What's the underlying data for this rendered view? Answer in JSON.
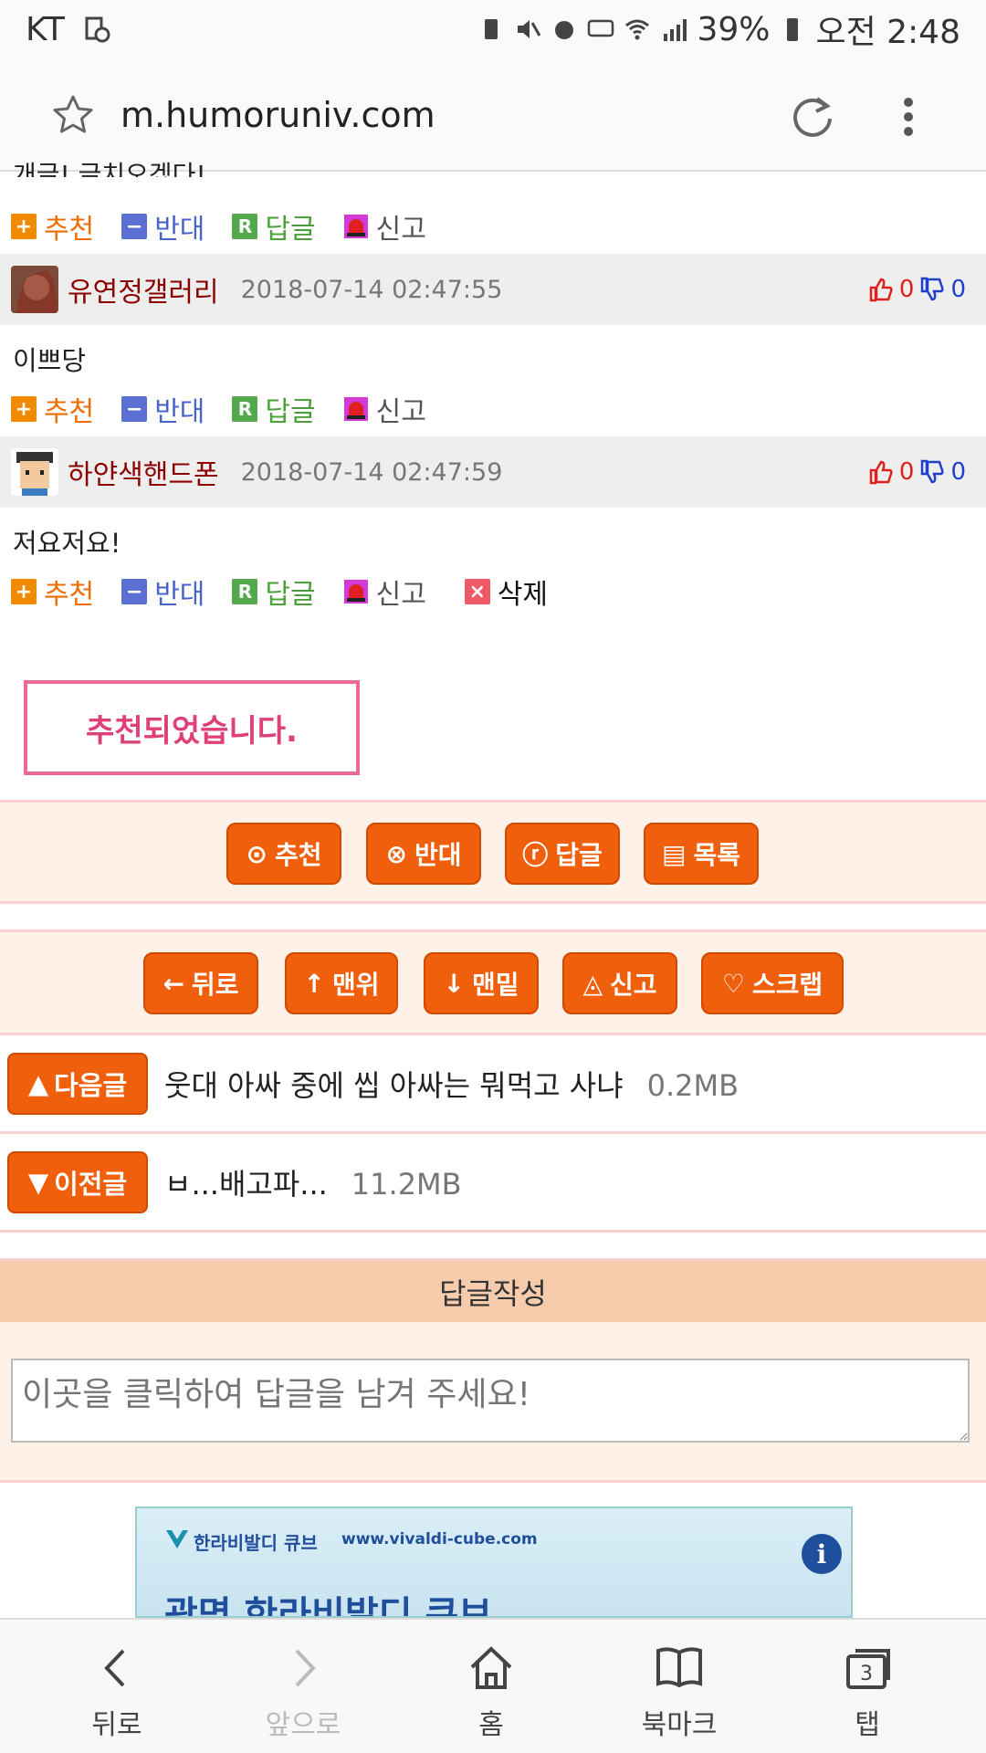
{
  "status_bar": {
    "carrier": "KT",
    "battery": "39%",
    "time": "오전 2:48"
  },
  "browser": {
    "url": "m.humoruniv.com"
  },
  "comment_actions": {
    "recommend": "추천",
    "oppose": "반대",
    "reply": "답글",
    "report": "신고",
    "delete": "삭제",
    "recommend_symbol": "+",
    "oppose_symbol": "−",
    "reply_symbol": "R",
    "delete_symbol": "×"
  },
  "truncated_text": "개글! 글치오겠다!",
  "comments": [
    {
      "nickname": "유연정갤러리",
      "time": "2018-07-14 02:47:55",
      "up": "0",
      "down": "0",
      "text": "이쁘당"
    },
    {
      "nickname": "하얀색핸드폰",
      "time": "2018-07-14 02:47:59",
      "up": "0",
      "down": "0",
      "text": "저요저요!"
    }
  ],
  "notice": "추천되었습니다.",
  "post_buttons": [
    {
      "icon": "⊙",
      "label": "추천"
    },
    {
      "icon": "⊗",
      "label": "반대"
    },
    {
      "icon": "ⓡ",
      "label": "답글"
    },
    {
      "icon": "▤",
      "label": "목록"
    }
  ],
  "nav_buttons": [
    {
      "icon": "←",
      "label": "뒤로"
    },
    {
      "icon": "↑",
      "label": "맨위"
    },
    {
      "icon": "↓",
      "label": "맨밑"
    },
    {
      "icon": "◬",
      "label": "신고"
    },
    {
      "icon": "♡",
      "label": "스크랩"
    }
  ],
  "next_post": {
    "label": "다음글",
    "icon": "▲",
    "title": "웃대 아싸 중에 씹 아싸는 뭐먹고 사냐",
    "size": "0.2MB"
  },
  "prev_post": {
    "label": "이전글",
    "icon": "▼",
    "title": "ㅂ...배고파...",
    "size": "11.2MB"
  },
  "reply_section": {
    "title": "답글작성",
    "placeholder": "이곳을 클릭하여 답글을 남겨 주세요!"
  },
  "ad": {
    "brand": "한라비발디 큐브",
    "site": "www.vivaldi-cube.com",
    "headline": "광명 한라비발디 큐브",
    "info": "i"
  },
  "bottom_nav": {
    "back": "뒤로",
    "forward": "앞으로",
    "home": "홈",
    "bookmarks": "북마크",
    "tabs": "탭",
    "tab_count": "3"
  },
  "colors": {
    "accent_orange": "#ef5f0c",
    "nickname": "#8b0000",
    "notice_pink": "#e0407a",
    "reply_header": "#f7ccac"
  }
}
